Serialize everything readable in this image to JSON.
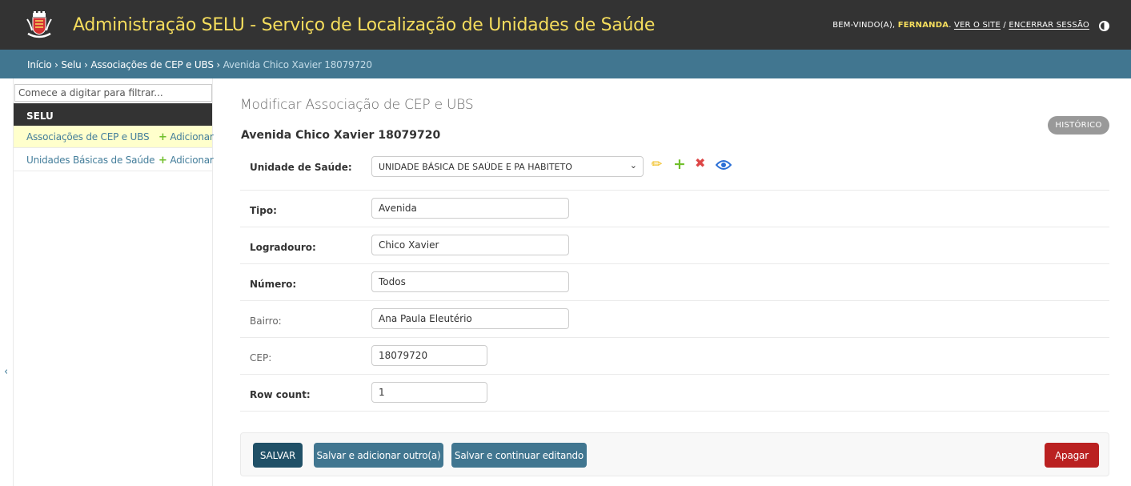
{
  "header": {
    "title": "Administração SELU - Serviço de Localização de Unidades de Saúde",
    "welcome": "BEM-VINDO(A), ",
    "username": "FERNANDA",
    "view_site": "VER O SITE",
    "separator": " / ",
    "logout": "ENCERRAR SESSÃO",
    "logo_icon": "city-coat-of-arms-logo",
    "theme_icon": "half-circle-theme-icon"
  },
  "breadcrumbs": {
    "items": [
      "Início",
      "Selu",
      "Associações de CEP e UBS"
    ],
    "sep": " › ",
    "current": "Avenida Chico Xavier 18079720"
  },
  "sidebar": {
    "filter_placeholder": "Comece a digitar para filtrar...",
    "app_name": "SELU",
    "models": [
      {
        "name": "Associações de CEP e UBS",
        "add": "Adicionar",
        "active": true
      },
      {
        "name": "Unidades Básicas de Saúde",
        "add": "Adicionar",
        "active": false
      }
    ],
    "collapse_icon": "‹"
  },
  "main": {
    "heading": "Modificar Associação de CEP e UBS",
    "object_title": "Avenida Chico Xavier 18079720",
    "history": "HISTÓRICO",
    "fields": {
      "unidade": {
        "label": "Unidade de Saúde:",
        "value": "UNIDADE BÁSICA DE SAÚDE E PA HABITETO"
      },
      "tipo": {
        "label": "Tipo:",
        "value": "Avenida"
      },
      "logradouro": {
        "label": "Logradouro:",
        "value": "Chico Xavier"
      },
      "numero": {
        "label": "Número:",
        "value": "Todos"
      },
      "bairro": {
        "label": "Bairro:",
        "value": "Ana Paula Eleutério"
      },
      "cep": {
        "label": "CEP:",
        "value": "18079720"
      },
      "row_count": {
        "label": "Row count:",
        "value": "1"
      }
    },
    "related_icons": [
      "pencil-icon",
      "plus-icon",
      "x-icon",
      "eye-icon"
    ]
  },
  "actions": {
    "save": "SALVAR",
    "save_add": "Salvar e adicionar outro(a)",
    "save_continue": "Salvar e continuar editando",
    "delete": "Apagar"
  },
  "colors": {
    "header_bg": "#333333",
    "header_title": "#f5dd5d",
    "breadcrumb_bg": "#417690",
    "link": "#447e9b",
    "add_plus": "#70bf2b",
    "delete": "#ba2121",
    "save": "#205067"
  }
}
